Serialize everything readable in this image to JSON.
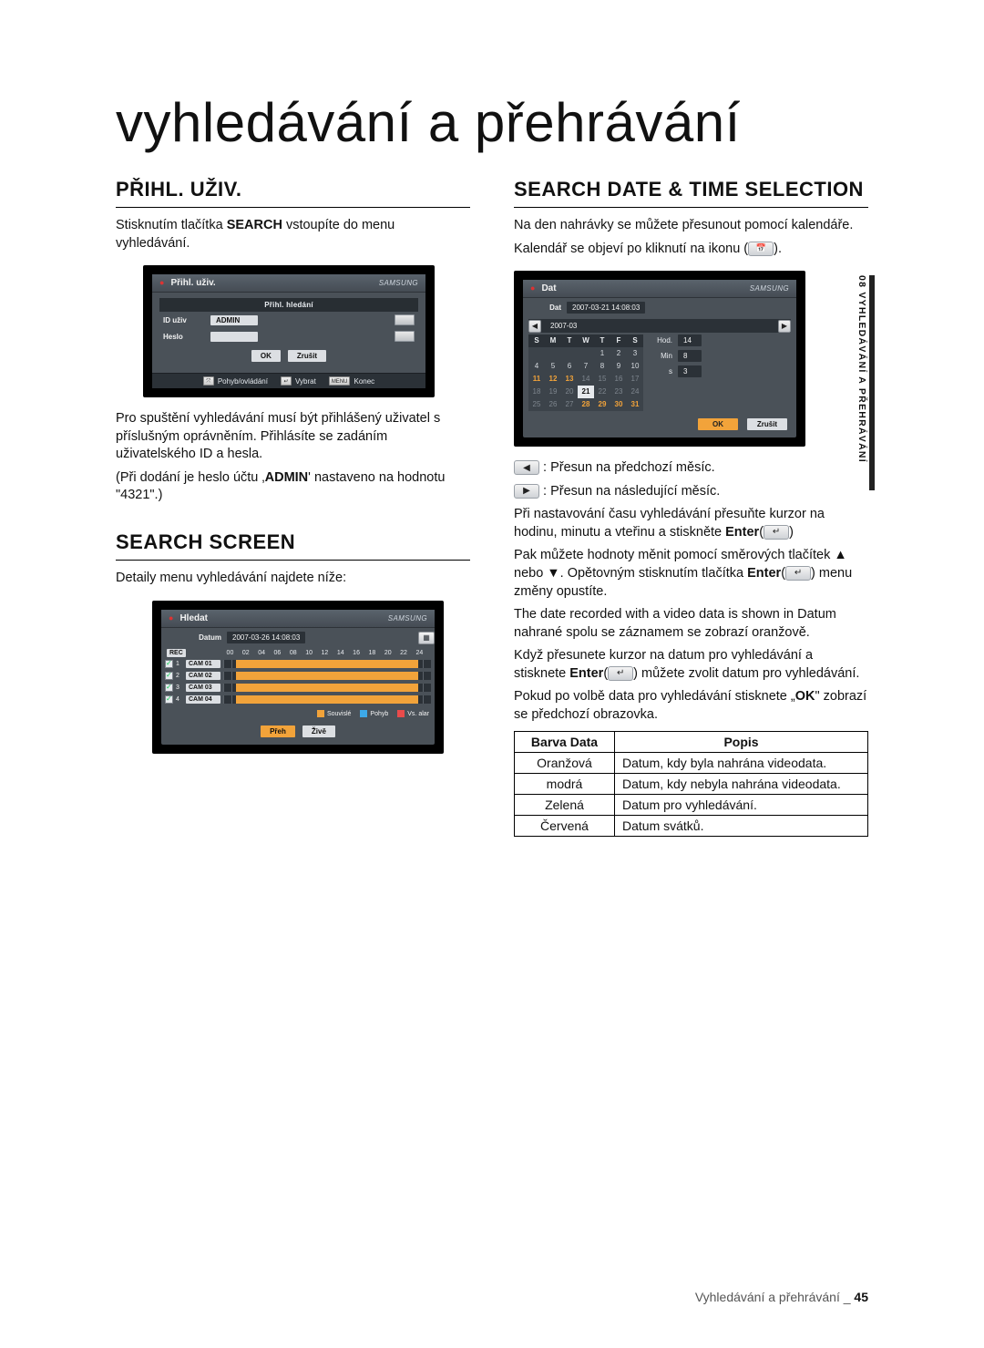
{
  "page": {
    "title": "vyhledávání a přehrávání",
    "side_tab": "08 VYHLEDÁVÁNÍ A PŘEHRÁVÁNÍ",
    "footer_text": "Vyhledávání a přehrávání _",
    "footer_page": "45"
  },
  "left": {
    "h1": "PŘIHL. UŽIV.",
    "p1a": "Stisknutím tlačítka ",
    "p1b": "SEARCH",
    "p1c": " vstoupíte do menu vyhledávání.",
    "after1": "Pro spuštění vyhledávání musí být přihlášený uživatel s příslušným oprávněním. Přihlásíte se zadáním uživatelského ID a hesla.",
    "after2a": "(Při dodání je heslo účtu ‚",
    "after2b": "ADMIN",
    "after2c": "' nastaveno na hodnotu \"4321\".)",
    "h2": "SEARCH SCREEN",
    "p2": "Detaily menu vyhledávání najdete níže:"
  },
  "right": {
    "h1": "SEARCH DATE & TIME SELECTION",
    "p1": "Na den nahrávky se můžete přesunout pomocí kalendáře.",
    "p2": "Kalendář se objeví po kliknutí na ikonu (",
    "p2_icon": "calendar-icon",
    "p2_end": ").",
    "prev": " : Přesun na předchozí měsíc.",
    "next": " : Přesun na následující měsíc.",
    "para_a": "Při nastavování času vyhledávání přesuňte kurzor na hodinu, minutu a vteřinu a stiskněte  ",
    "para_a_b": "Enter",
    "para_b": "Pak můžete hodnoty měnit pomocí směrových tlačítek ▲ nebo ▼. Opětovným stisknutím tlačítka ",
    "para_b_b": "Enter",
    "para_b_end": " menu změny opustíte.",
    "para_c": "The date recorded with a video data is shown in Datum nahrané spolu se záznamem se zobrazí oranžově.",
    "para_d": "Když přesunete kurzor na datum pro vyhledávání a stisknete ",
    "para_d_b": "Enter",
    "para_d_end": " můžete zvolit datum pro vyhledávání.",
    "para_e": "Pokud po volbě data pro vyhledávání stisknete „",
    "para_e_b": "OK",
    "para_e_end": "\" zobrazí se předchozí obrazovka."
  },
  "shot_login": {
    "title": "Přihl. uživ.",
    "brand": "SAMSUNG",
    "header": "Přihl. hledání",
    "id_label": "ID uživ",
    "id_value": "ADMIN",
    "pw_label": "Heslo",
    "ok": "OK",
    "cancel": "Zrušit",
    "status_move": "Pohyb/ovládání",
    "status_select": "Vybrat",
    "status_end_btn": "MENU",
    "status_end": "Konec"
  },
  "shot_search": {
    "title": "Hledat",
    "brand": "SAMSUNG",
    "date_label": "Datum",
    "date_value": "2007-03-26  14:08:03",
    "rec_icon_label": "REC",
    "hours": [
      "00",
      "02",
      "04",
      "06",
      "08",
      "10",
      "12",
      "14",
      "16",
      "18",
      "20",
      "22",
      "24"
    ],
    "cams": [
      {
        "n": "1",
        "name": "CAM 01"
      },
      {
        "n": "2",
        "name": "CAM 02"
      },
      {
        "n": "3",
        "name": "CAM 03"
      },
      {
        "n": "4",
        "name": "CAM 04"
      }
    ],
    "legend": [
      {
        "color": "#f2a33a",
        "label": "Souvislé"
      },
      {
        "color": "#3da9e8",
        "label": "Pohyb"
      },
      {
        "color": "#e94b4b",
        "label": "Vs. alar"
      }
    ],
    "btn_play": "Přeh",
    "btn_live": "Živě"
  },
  "shot_date": {
    "title": "Dat",
    "brand": "SAMSUNG",
    "date_label": "Dat",
    "date_value": "2007-03-21  14:08:03",
    "month": "2007-03",
    "dow": [
      "S",
      "M",
      "T",
      "W",
      "T",
      "F",
      "S"
    ],
    "days": [
      {
        "t": "",
        "c": "d dim"
      },
      {
        "t": "",
        "c": "d dim"
      },
      {
        "t": "",
        "c": "d dim"
      },
      {
        "t": "",
        "c": "d dim"
      },
      {
        "t": "1",
        "c": "d"
      },
      {
        "t": "2",
        "c": "d"
      },
      {
        "t": "3",
        "c": "d"
      },
      {
        "t": "4",
        "c": "d"
      },
      {
        "t": "5",
        "c": "d"
      },
      {
        "t": "6",
        "c": "d"
      },
      {
        "t": "7",
        "c": "d"
      },
      {
        "t": "8",
        "c": "d"
      },
      {
        "t": "9",
        "c": "d"
      },
      {
        "t": "10",
        "c": "d"
      },
      {
        "t": "11",
        "c": "d orange"
      },
      {
        "t": "12",
        "c": "d orange"
      },
      {
        "t": "13",
        "c": "d orange"
      },
      {
        "t": "14",
        "c": "d dim"
      },
      {
        "t": "15",
        "c": "d dim"
      },
      {
        "t": "16",
        "c": "d dim"
      },
      {
        "t": "17",
        "c": "d dim"
      },
      {
        "t": "18",
        "c": "d dim"
      },
      {
        "t": "19",
        "c": "d dim"
      },
      {
        "t": "20",
        "c": "d dim"
      },
      {
        "t": "21",
        "c": "d sel"
      },
      {
        "t": "22",
        "c": "d dim"
      },
      {
        "t": "23",
        "c": "d dim"
      },
      {
        "t": "24",
        "c": "d dim"
      },
      {
        "t": "25",
        "c": "d dim"
      },
      {
        "t": "26",
        "c": "d dim"
      },
      {
        "t": "27",
        "c": "d dim"
      },
      {
        "t": "28",
        "c": "d orange"
      },
      {
        "t": "29",
        "c": "d orange"
      },
      {
        "t": "30",
        "c": "d orange"
      },
      {
        "t": "31",
        "c": "d orange"
      }
    ],
    "time_rows": [
      {
        "label": "Hod.",
        "value": "14"
      },
      {
        "label": "Min",
        "value": "8"
      },
      {
        "label": "s",
        "value": "3"
      }
    ],
    "ok": "OK",
    "cancel": "Zrušit"
  },
  "legend_table": {
    "h1": "Barva Data",
    "h2": "Popis",
    "rows": [
      {
        "c": "Oranžová",
        "d": "Datum, kdy byla nahrána videodata."
      },
      {
        "c": "modrá",
        "d": "Datum, kdy nebyla nahrána videodata."
      },
      {
        "c": "Zelená",
        "d": "Datum pro vyhledávání."
      },
      {
        "c": "Červená",
        "d": "Datum svátků."
      }
    ]
  }
}
